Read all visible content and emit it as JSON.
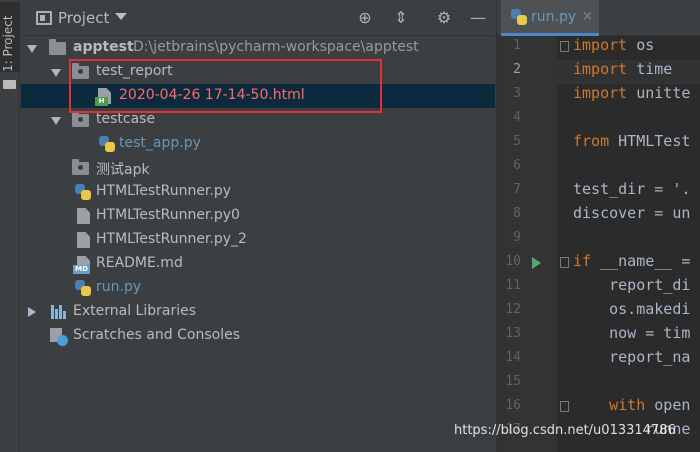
{
  "side_strip": {
    "tab_label": "1: Project"
  },
  "panel": {
    "title": "Project"
  },
  "tree": {
    "root": {
      "name": "apptest",
      "path": "D:\\jetbrains\\pycharm-workspace\\apptest"
    },
    "test_report": {
      "name": "test_report"
    },
    "report_file": {
      "name": "2020-04-26 17-14-50.html",
      "badge": "H"
    },
    "testcase": {
      "name": "testcase"
    },
    "test_app": {
      "name": "test_app.py"
    },
    "apk_dir": {
      "name": "测试apk"
    },
    "runner_py": {
      "name": "HTMLTestRunner.py"
    },
    "runner_py0": {
      "name": "HTMLTestRunner.py0"
    },
    "runner_py2": {
      "name": "HTMLTestRunner.py_2"
    },
    "readme": {
      "name": "README.md",
      "badge": "MD"
    },
    "run_py": {
      "name": "run.py"
    },
    "ext_libs": {
      "name": "External Libraries"
    },
    "scratches": {
      "name": "Scratches and Consoles"
    }
  },
  "editor": {
    "tab": {
      "label": "run.py",
      "close": "×"
    },
    "line_numbers": [
      "1",
      "2",
      "3",
      "4",
      "5",
      "6",
      "7",
      "8",
      "9",
      "10",
      "11",
      "12",
      "13",
      "14",
      "15",
      "16",
      "17"
    ],
    "lines": [
      {
        "kw": "import",
        "rest": " os"
      },
      {
        "kw": "import",
        "rest": " time"
      },
      {
        "kw": "import",
        "rest": " unitte"
      },
      {
        "kw": "",
        "rest": ""
      },
      {
        "kw": "from",
        "rest": " HTMLTest"
      },
      {
        "kw": "",
        "rest": ""
      },
      {
        "kw": "",
        "rest": "test_dir = '."
      },
      {
        "kw": "",
        "rest": "discover = un"
      },
      {
        "kw": "",
        "rest": ""
      },
      {
        "kw": "if",
        "rest": " __name__ ="
      },
      {
        "kw": "",
        "rest": "    report_di"
      },
      {
        "kw": "",
        "rest": "    os.makedi"
      },
      {
        "kw": "",
        "rest": "    now = tim"
      },
      {
        "kw": "",
        "rest": "    report_na"
      },
      {
        "kw": "",
        "rest": ""
      },
      {
        "kw": "    with",
        "rest": " open"
      },
      {
        "kw": "",
        "rest": "        runne"
      }
    ]
  },
  "watermark": "https://blog.csdn.net/u013314786"
}
